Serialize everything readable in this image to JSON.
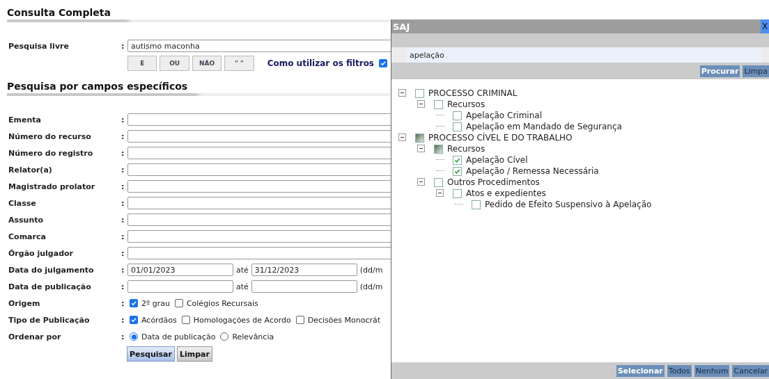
{
  "page": {
    "title": "Consulta Completa",
    "free_search": {
      "label": "Pesquisa livre",
      "separator": ":",
      "value": "autismo maconha",
      "operators": [
        "E",
        "OU",
        "NÃO",
        "\" \""
      ],
      "help_link": "Como utilizar os filtros",
      "help_checked": true
    },
    "section_title": "Pesquisa por campos específicos",
    "fields": [
      {
        "kind": "text",
        "label": "Ementa",
        "separator": ":"
      },
      {
        "kind": "text",
        "label": "Número do recurso",
        "separator": ":"
      },
      {
        "kind": "text",
        "label": "Número do registro",
        "separator": ":"
      },
      {
        "kind": "text",
        "label": "Relator(a)",
        "separator": ":"
      },
      {
        "kind": "text",
        "label": "Magistrado prolator",
        "separator": ":"
      },
      {
        "kind": "text",
        "label": "Classe",
        "separator": ":"
      },
      {
        "kind": "text",
        "label": "Assunto",
        "separator": ":"
      },
      {
        "kind": "text",
        "label": "Comarca",
        "separator": ":"
      },
      {
        "kind": "text",
        "label": "Órgão julgador",
        "separator": ":"
      },
      {
        "kind": "date",
        "label": "Data do julgamento",
        "separator": ":",
        "from": "01/01/2023",
        "to_label": "até",
        "to": "31/12/2023",
        "hint": "(dd/m"
      },
      {
        "kind": "date",
        "label": "Data de publicação",
        "separator": ":",
        "to_label": "até",
        "hint": "(dd/m"
      },
      {
        "kind": "checks",
        "label": "Origem",
        "separator": ":",
        "options": [
          {
            "label": "2º grau",
            "checked": true
          },
          {
            "label": "Colégios Recursais",
            "checked": false
          }
        ]
      },
      {
        "kind": "checks",
        "label": "Tipo de Publicação",
        "separator": ":",
        "options": [
          {
            "label": "Acórdãos",
            "checked": true
          },
          {
            "label": "Homologações de Acordo",
            "checked": false
          },
          {
            "label": "Decisões Monocrát",
            "checked": false
          }
        ]
      },
      {
        "kind": "radios",
        "label": "Ordenar por",
        "separator": ":",
        "options": [
          {
            "label": "Data de publicação",
            "selected": true
          },
          {
            "label": "Relevância",
            "selected": false
          }
        ]
      }
    ],
    "buttons": [
      {
        "label": "Pesquisar",
        "primary": true
      },
      {
        "label": "Limpar",
        "primary": false
      }
    ]
  },
  "dialog": {
    "title": "SAJ",
    "close": "X",
    "search_value": "apelação",
    "search_buttons": [
      {
        "label": "Procurar",
        "primary": true
      },
      {
        "label": "Limpa",
        "primary": false
      }
    ],
    "tree": [
      {
        "label": "PROCESSO CRIMINAL",
        "checked": false,
        "partial": false,
        "expanded": true,
        "children": [
          {
            "label": "Recursos",
            "checked": false,
            "partial": false,
            "expanded": true,
            "children": [
              {
                "label": "Apelação Criminal",
                "checked": false,
                "partial": false
              },
              {
                "label": "Apelação em Mandado de Segurança",
                "checked": false,
                "partial": false
              }
            ]
          }
        ]
      },
      {
        "label": "PROCESSO CÍVEL E DO TRABALHO",
        "checked": false,
        "partial": true,
        "expanded": true,
        "children": [
          {
            "label": "Recursos",
            "checked": false,
            "partial": true,
            "expanded": true,
            "children": [
              {
                "label": "Apelação Cível",
                "checked": true,
                "partial": false
              },
              {
                "label": "Apelação / Remessa Necessária",
                "checked": true,
                "partial": false
              }
            ]
          },
          {
            "label": "Outros Procedimentos",
            "checked": false,
            "partial": false,
            "expanded": true,
            "children": [
              {
                "label": "Atos e expedientes",
                "checked": false,
                "partial": false,
                "expanded": true,
                "children": [
                  {
                    "label": "Pedido de Efeito Suspensivo à Apelação",
                    "checked": false,
                    "partial": false
                  }
                ]
              }
            ]
          }
        ]
      }
    ],
    "footer_buttons": [
      {
        "label": "Selecionar",
        "primary": true
      },
      {
        "label": "Todos",
        "primary": false
      },
      {
        "label": "Nenhum",
        "primary": false
      },
      {
        "label": "Cancelar",
        "primary": false
      }
    ]
  }
}
